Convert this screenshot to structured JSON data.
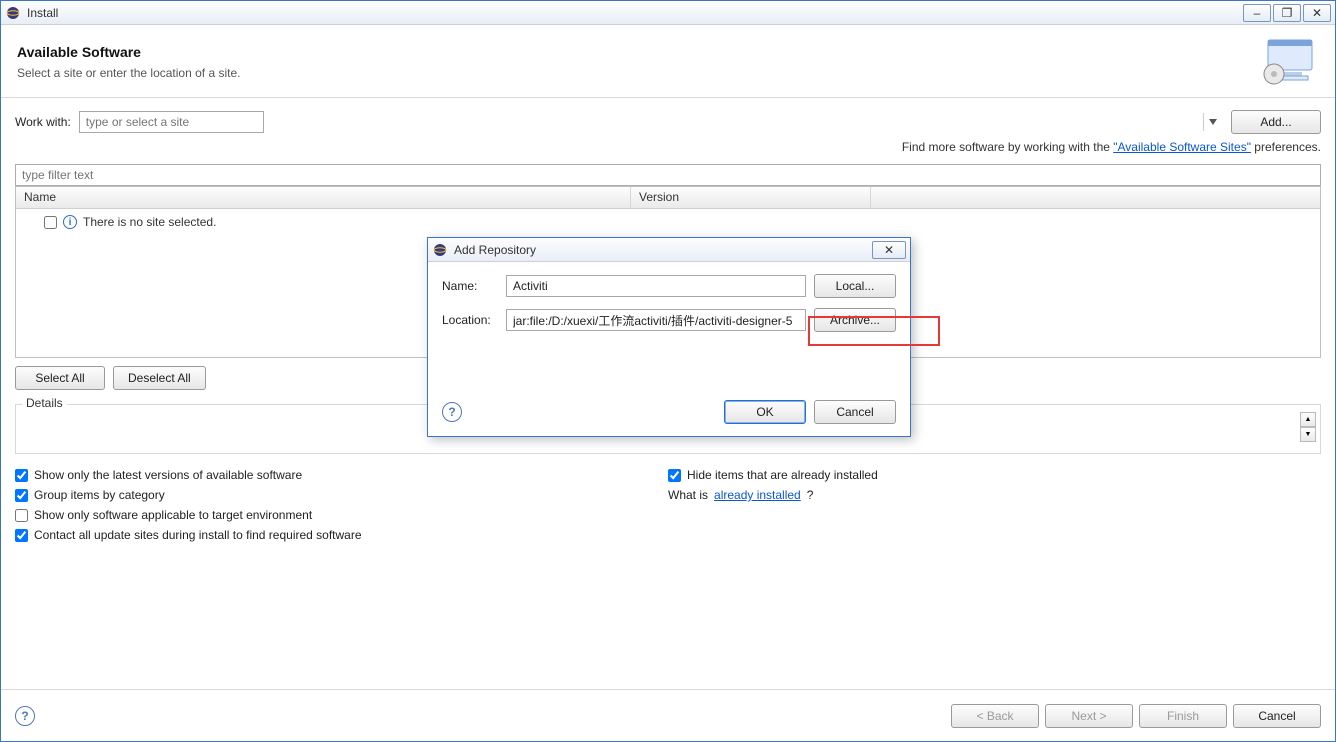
{
  "window": {
    "title": "Install",
    "min_tip": "–",
    "max_tip": "❐",
    "close_tip": "✕"
  },
  "header": {
    "title": "Available Software",
    "subtitle": "Select a site or enter the location of a site."
  },
  "workwith": {
    "label": "Work with:",
    "placeholder": "type or select a site",
    "add": "Add..."
  },
  "hint": {
    "prefix": "Find more software by working with the ",
    "link": "\"Available Software Sites\"",
    "suffix": " preferences."
  },
  "filter": {
    "placeholder": "type filter text"
  },
  "table": {
    "col_name": "Name",
    "col_version": "Version",
    "empty_msg": "There is no site selected."
  },
  "selbtns": {
    "select_all": "Select All",
    "deselect_all": "Deselect All"
  },
  "details": {
    "legend": "Details"
  },
  "checks": {
    "latest": "Show only the latest versions of available software",
    "hide_installed": "Hide items that are already installed",
    "group": "Group items by category",
    "whatis_prefix": "What is ",
    "whatis_link": "already installed",
    "whatis_suffix": "?",
    "target_env": "Show only software applicable to target environment",
    "contact": "Contact all update sites during install to find required software"
  },
  "footer": {
    "back": "< Back",
    "next": "Next >",
    "finish": "Finish",
    "cancel": "Cancel"
  },
  "modal": {
    "title": "Add Repository",
    "close": "✕",
    "name_label": "Name:",
    "name_value": "Activiti",
    "local": "Local...",
    "location_label": "Location:",
    "location_value": "jar:file:/D:/xuexi/工作流activiti/插件/activiti-designer-5",
    "archive": "Archive...",
    "ok": "OK",
    "cancel": "Cancel"
  }
}
